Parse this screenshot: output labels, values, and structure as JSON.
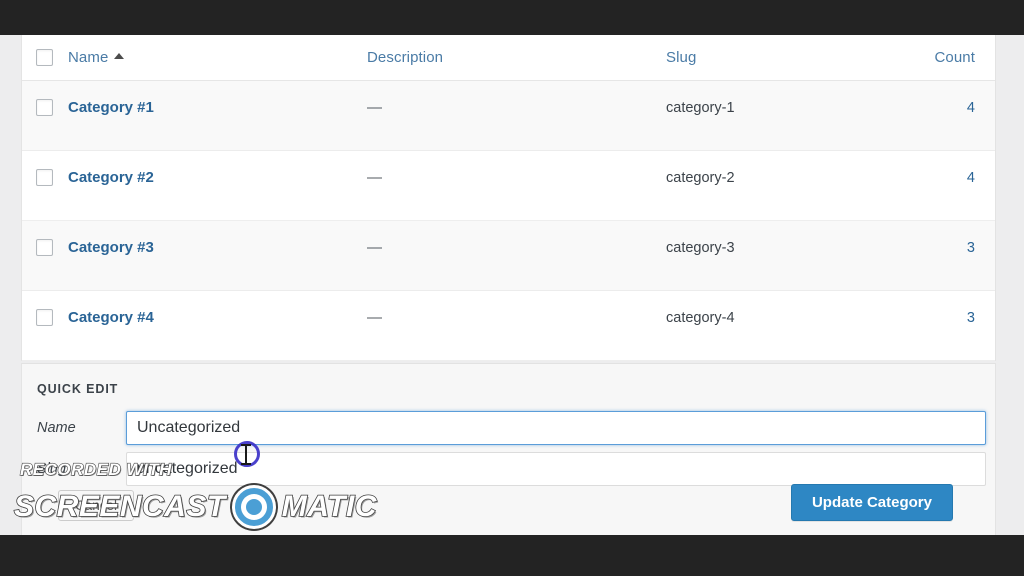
{
  "table": {
    "columns": [
      {
        "key": "checkbox",
        "label": ""
      },
      {
        "key": "name",
        "label": "Name"
      },
      {
        "key": "description",
        "label": "Description"
      },
      {
        "key": "slug",
        "label": "Slug"
      },
      {
        "key": "count",
        "label": "Count"
      }
    ],
    "sort": {
      "column": "Name",
      "direction": "asc",
      "glyph": "sort-asc-arrow-icon"
    },
    "rows": [
      {
        "name": "Category #1",
        "description": "—",
        "slug": "category-1",
        "count": "4"
      },
      {
        "name": "Category #2",
        "description": "—",
        "slug": "category-2",
        "count": "4"
      },
      {
        "name": "Category #3",
        "description": "—",
        "slug": "category-3",
        "count": "3"
      },
      {
        "name": "Category #4",
        "description": "—",
        "slug": "category-4",
        "count": "3"
      }
    ]
  },
  "quick_edit": {
    "legend": "QUICK EDIT",
    "fields": [
      {
        "label": "Name",
        "value": "Uncategorized",
        "focused": true
      },
      {
        "label": "Slug",
        "value": "uncategorized",
        "focused": false
      }
    ],
    "cancel_label": "Cancel",
    "submit_label": "Update Category"
  },
  "watermark": {
    "top_line": "RECORDED WITH",
    "word_left": "SCREENCAST",
    "word_right": "MATIC",
    "logo": "screencast-o-matic-target-icon"
  },
  "colors": {
    "letterbox": "#232323",
    "link_blue": "#2a6496",
    "header_link_blue": "#4a7ba6",
    "primary_button": "#2e87c4",
    "focus_border": "#5b9dd9",
    "cursor_ring": "#3b31c8",
    "page_background": "#ededee",
    "row_alt": "#f9f9f9",
    "quick_edit_background": "#f7f7f7"
  }
}
